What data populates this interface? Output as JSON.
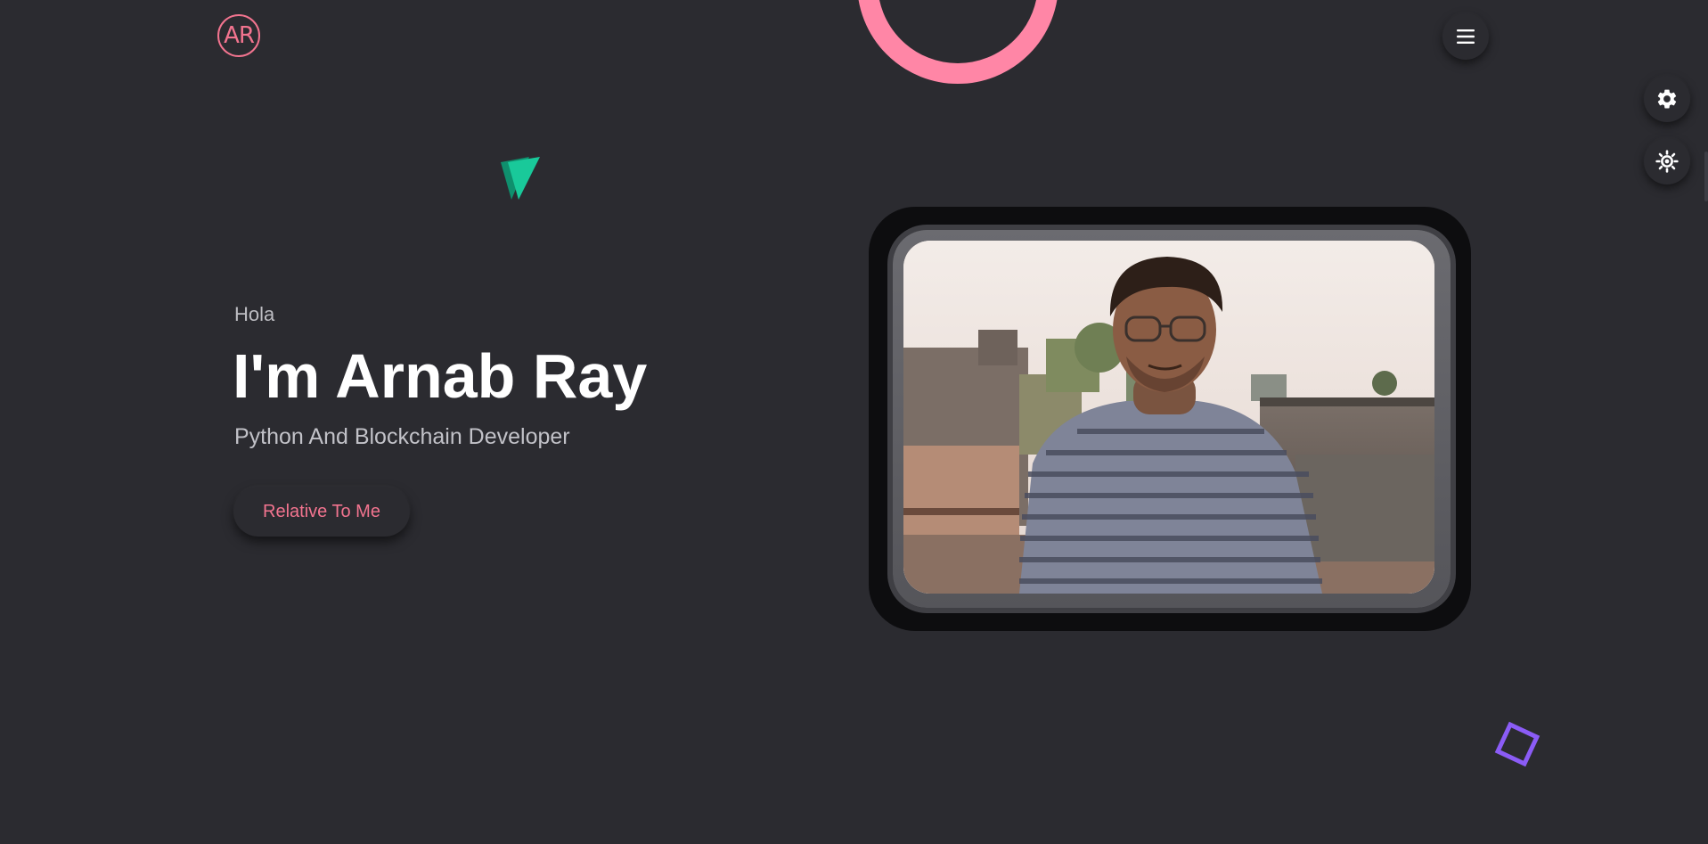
{
  "header": {
    "logo_text": "AR",
    "menu_icon": "hamburger-menu-icon"
  },
  "side_controls": {
    "settings_icon": "gear-icon",
    "theme_icon": "sun-icon"
  },
  "hero": {
    "greeting": "Hola",
    "name": "I'm Arnab Ray",
    "role": "Python And Blockchain Developer",
    "cta_label": "Relative To Me"
  },
  "decorations": {
    "ring_color": "#ff86a6",
    "triangle_color": "#19c99a",
    "square_color": "#8b5cf6"
  },
  "colors": {
    "background": "#2b2b30",
    "accent": "#f2748f",
    "text_primary": "#ffffff",
    "text_secondary": "#c2c2c8"
  }
}
